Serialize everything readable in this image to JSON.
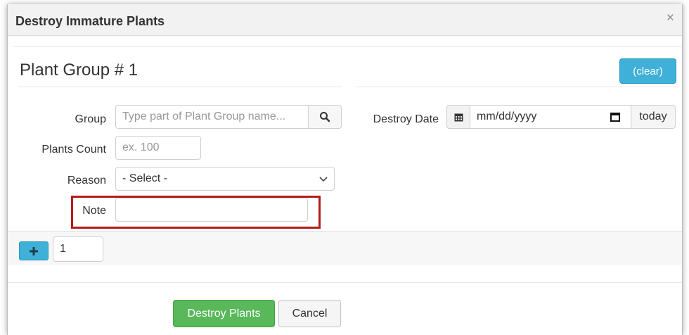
{
  "modal": {
    "title": "Destroy Immature Plants",
    "close_glyph": "×"
  },
  "plant_group": {
    "title": "Plant Group # 1",
    "clear_label": "(clear)"
  },
  "fields": {
    "group_label": "Group",
    "group_placeholder": "Type part of Plant Group name...",
    "plants_count_label": "Plants Count",
    "plants_count_placeholder": "ex. 100",
    "reason_label": "Reason",
    "reason_selected": "- Select -",
    "note_label": "Note",
    "note_value": "",
    "destroy_date_label": "Destroy Date",
    "destroy_date_placeholder": "mm/dd/yyyy",
    "today_label": "today"
  },
  "add_row": {
    "count_value": "1"
  },
  "footer": {
    "destroy_label": "Destroy Plants",
    "cancel_label": "Cancel"
  },
  "colors": {
    "accent_blue": "#3fb1d8",
    "success_green": "#59b85a",
    "highlight_red": "#b31b1b"
  },
  "icons": [
    "search-icon",
    "calendar-icon",
    "calendar-picker-icon",
    "plus-icon",
    "chevron-down-icon",
    "close-icon"
  ]
}
